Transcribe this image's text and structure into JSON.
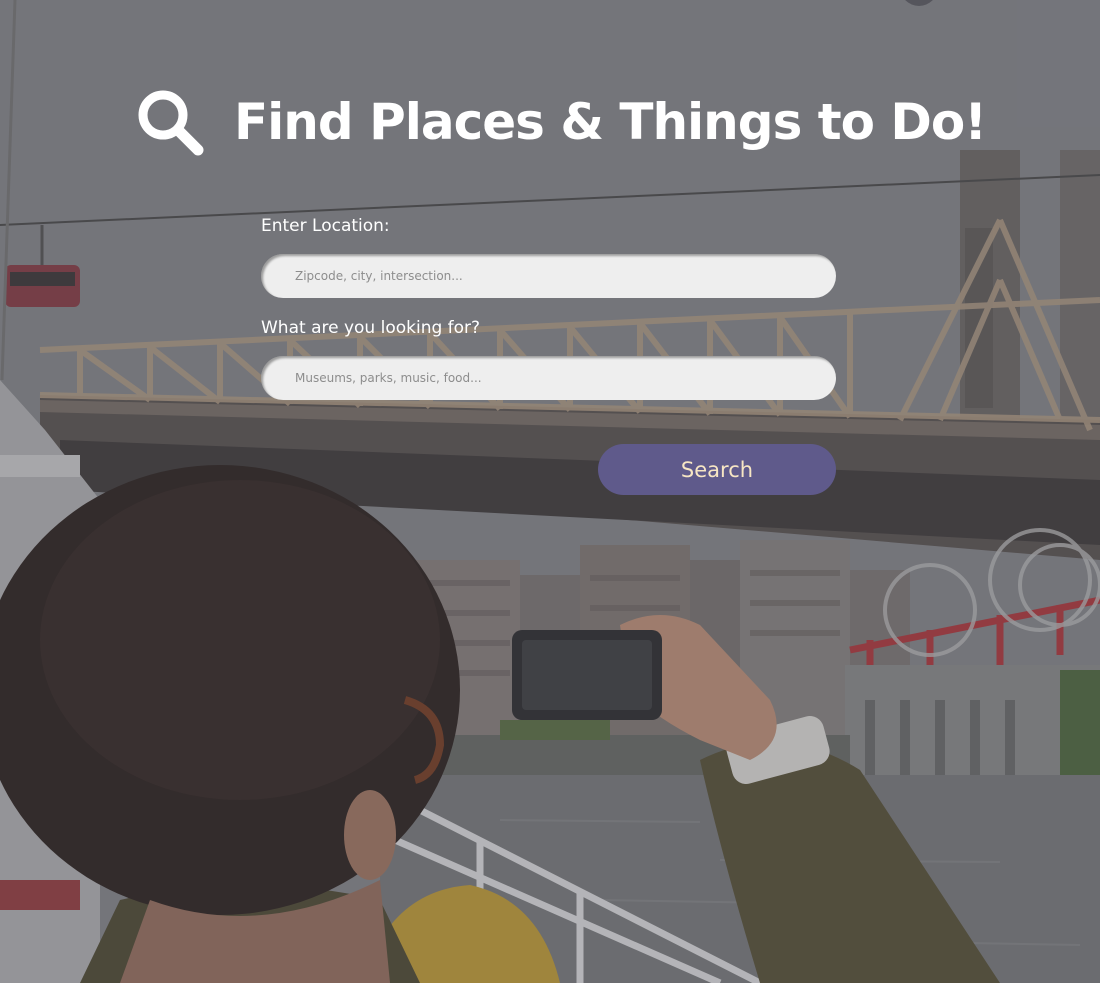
{
  "header": {
    "title": "Find Places & Things to Do!",
    "icon": "search-icon"
  },
  "form": {
    "location": {
      "label": "Enter Location:",
      "placeholder": "Zipcode, city, intersection...",
      "value": ""
    },
    "query": {
      "label": "What are you looking for?",
      "placeholder": "Museums, parks, music, food...",
      "value": ""
    },
    "submit_label": "Search"
  },
  "colors": {
    "button_background": "#5f5a8b",
    "button_text": "#f7e6c4",
    "input_background": "#eeeeee",
    "title_text": "#ffffff"
  }
}
